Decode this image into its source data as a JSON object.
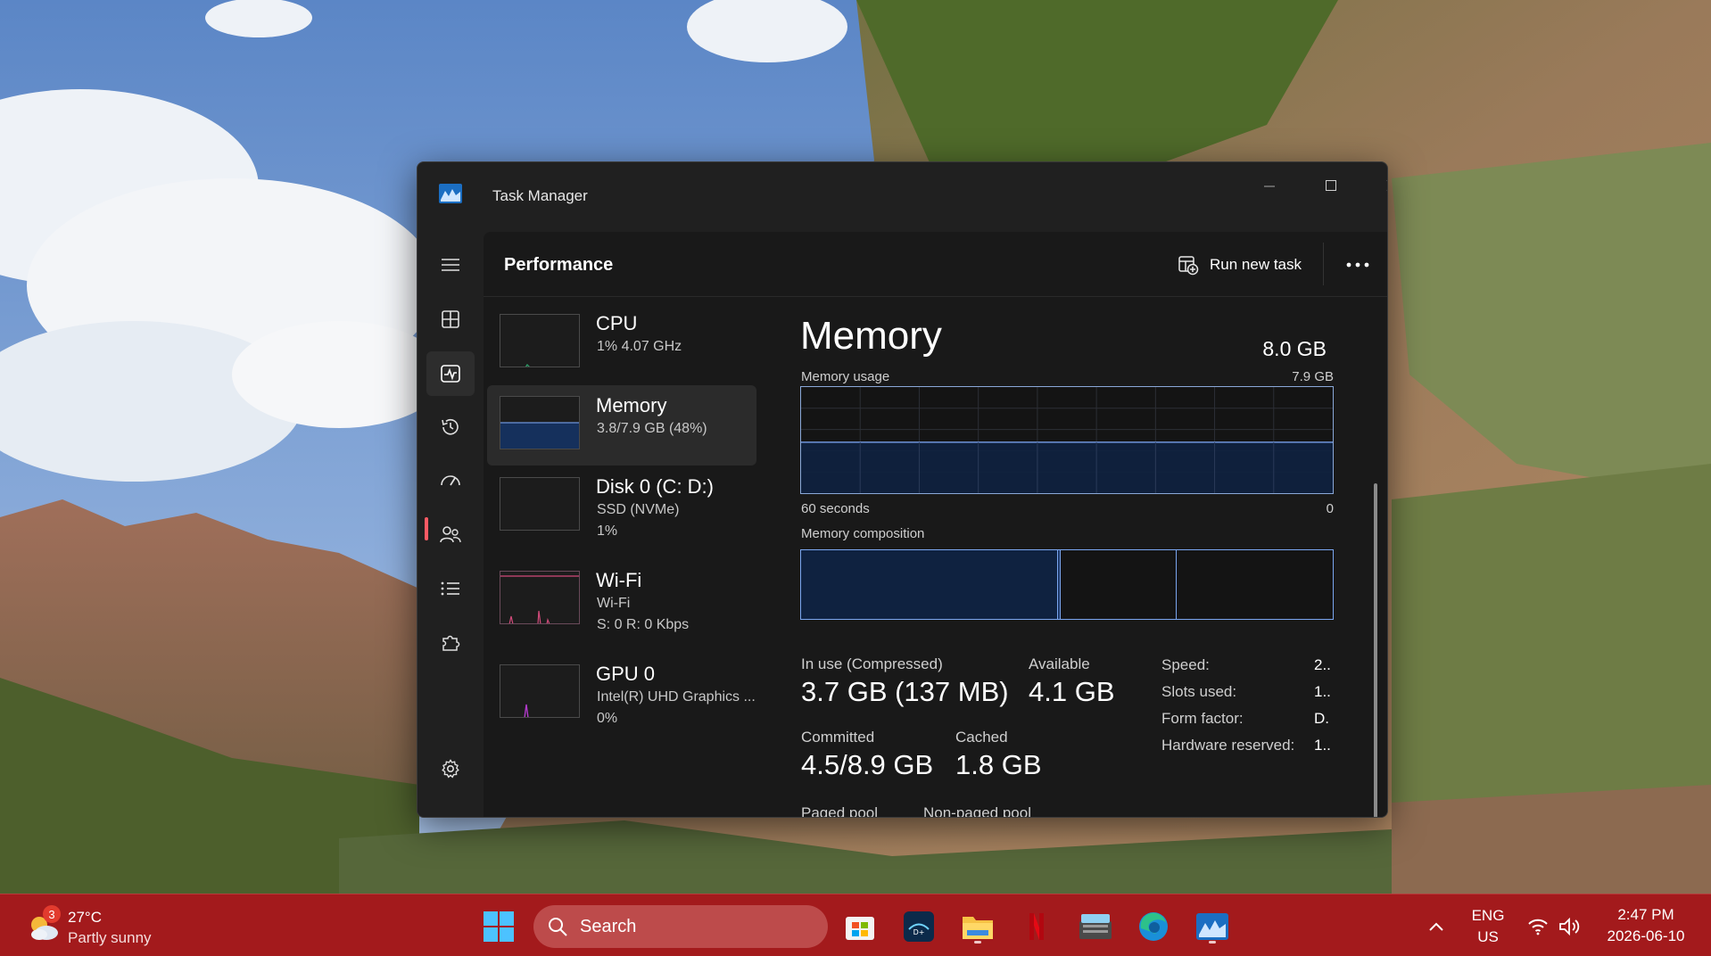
{
  "window": {
    "title": "Task Manager",
    "section_title": "Performance",
    "run_new_task": "Run new task",
    "more_label": "•••"
  },
  "devices": [
    {
      "name": "CPU",
      "sub1": "1%  4.07 GHz",
      "sub2": ""
    },
    {
      "name": "Memory",
      "sub1": "3.8/7.9 GB (48%)",
      "sub2": ""
    },
    {
      "name": "Disk 0 (C: D:)",
      "sub1": "SSD (NVMe)",
      "sub2": "1%"
    },
    {
      "name": "Wi-Fi",
      "sub1": "Wi-Fi",
      "sub2": "S: 0  R: 0 Kbps"
    },
    {
      "name": "GPU 0",
      "sub1": "Intel(R) UHD Graphics ...",
      "sub2": "0%"
    }
  ],
  "memory": {
    "title": "Memory",
    "total": "8.0 GB",
    "usage_label": "Memory usage",
    "usage_max": "7.9 GB",
    "time_left": "60 seconds",
    "time_right": "0",
    "usage_fraction": 0.48,
    "composition_label": "Memory composition",
    "stats": {
      "in_use_label": "In use (Compressed)",
      "in_use_value": "3.7 GB (137 MB)",
      "available_label": "Available",
      "available_value": "4.1 GB",
      "committed_label": "Committed",
      "committed_value": "4.5/8.9 GB",
      "cached_label": "Cached",
      "cached_value": "1.8 GB",
      "paged_label": "Paged pool",
      "nonpaged_label": "Non-paged pool"
    },
    "specs": [
      {
        "label": "Speed:",
        "value": "2.."
      },
      {
        "label": "Slots used:",
        "value": "1.."
      },
      {
        "label": "Form factor:",
        "value": "D."
      },
      {
        "label": "Hardware reserved:",
        "value": "1.."
      }
    ]
  },
  "taskbar": {
    "weather_badge": "3",
    "temperature": "27°C",
    "condition": "Partly sunny",
    "search_placeholder": "Search",
    "lang_top": "ENG",
    "lang_bottom": "US",
    "time": "2:47 PM",
    "date": "2026-06-10"
  },
  "colors": {
    "accent_red": "#ff5a64",
    "graph_fill": "#0f2240",
    "graph_line": "#6d94d8",
    "taskbar": "#a31a1c"
  }
}
